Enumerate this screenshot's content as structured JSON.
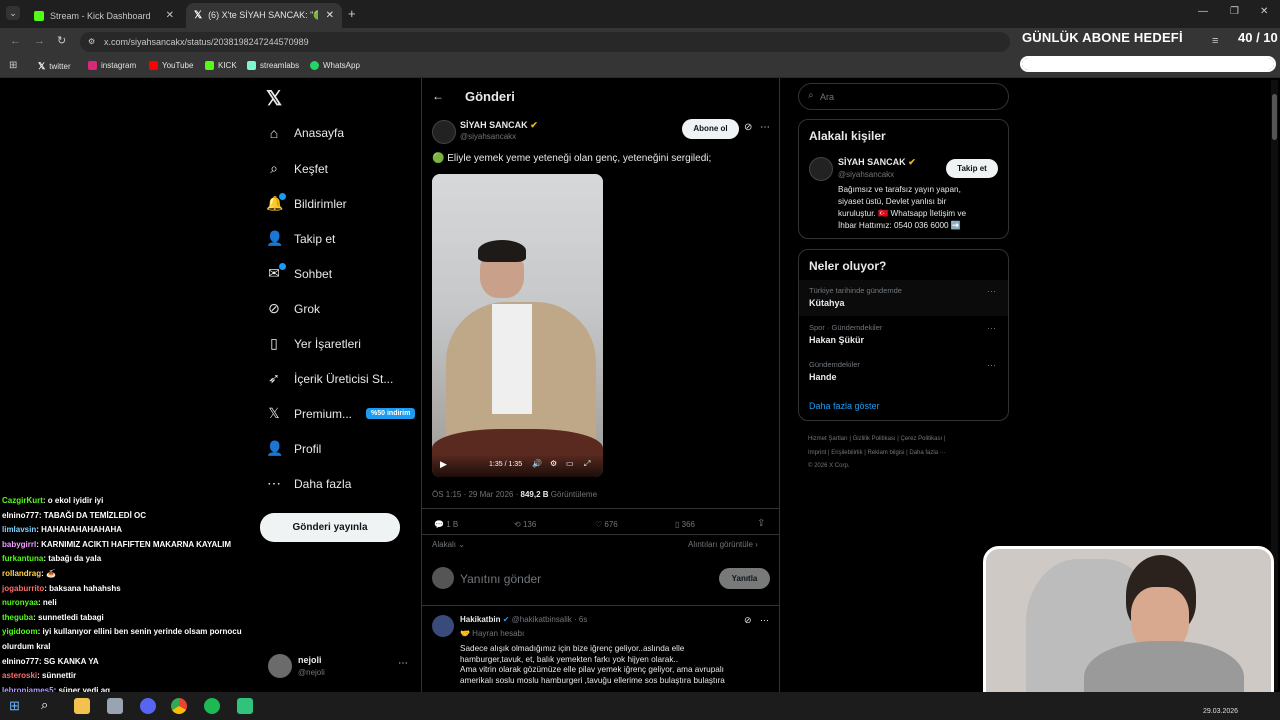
{
  "browser": {
    "tabs": [
      {
        "title": "Stream - Kick Dashboard"
      },
      {
        "title": "(6) X'te SİYAH SANCAK: \"🟢 Eli"
      }
    ],
    "url": "x.com/siyahsancakx/status/2038198247244570989",
    "bookmarks": [
      "twitter",
      "instagram",
      "YouTube",
      "KICK",
      "streamlabs",
      "WhatsApp"
    ]
  },
  "overlay": {
    "goal_title": "GÜNLÜK ABONE HEDEFİ",
    "goal_count": "40 / 10",
    "goal_progress": 1.0
  },
  "sidebar": {
    "items": [
      {
        "label": "Anasayfa",
        "icon": "home-icon"
      },
      {
        "label": "Keşfet",
        "icon": "search-icon"
      },
      {
        "label": "Bildirimler",
        "icon": "bell-icon"
      },
      {
        "label": "Takip et",
        "icon": "follow-icon"
      },
      {
        "label": "Sohbet",
        "icon": "mail-icon"
      },
      {
        "label": "Grok",
        "icon": "grok-icon"
      },
      {
        "label": "Yer İşaretleri",
        "icon": "bookmark-icon"
      },
      {
        "label": "İçerik Üreticisi St...",
        "icon": "rocket-icon"
      },
      {
        "label": "Premium...",
        "icon": "x-icon"
      },
      {
        "label": "Profil",
        "icon": "person-icon"
      },
      {
        "label": "Daha fazla",
        "icon": "more-icon"
      }
    ],
    "premium_badge": "%50 indirim",
    "post_button": "Gönderi yayınla",
    "account_name": "nejoli",
    "account_handle": "@nejoli"
  },
  "post": {
    "header": "Gönderi",
    "author": "SİYAH SANCAK",
    "handle": "@siyahsancakx",
    "subscribe": "Abone ol",
    "text": "🟢 Eliyle yemek yeme yeteneği olan genç, yeteneğini sergiledi;",
    "video_time": "1:35 / 1:35",
    "meta_time": "ÖS 1:15 · 29 Mar 2026 ·",
    "views": "849,2 B",
    "views_label": "Görüntüleme",
    "stats": {
      "replies": "1 B",
      "reposts": "136",
      "likes": "676",
      "bookmarks": "366"
    },
    "relevant": "Alakalı",
    "quotes": "Alıntıları görüntüle",
    "reply_placeholder": "Yanıtını gönder",
    "reply_button": "Yanıtla"
  },
  "reply": {
    "author": "Hakikatbin",
    "handle": "@hakikatbinsalik · 6s",
    "tag": "🤝 Hayran hesabı",
    "lines": [
      "Sadece alışık olmadığımız için bize iğrenç geliyor..aslında elle",
      "hamburger,tavuk, et, balık yemekten farkı yok hijyen olarak..",
      "Ama vitrin olarak gözümüze elle pilav yemek iğrenç geliyor, ama avrupalı",
      "amerikalı soslu moslu hamburgeri ,tavuğu ellerime sos bulaştıra bulaştıra"
    ]
  },
  "right": {
    "search_placeholder": "Ara",
    "relevant_title": "Alakalı kişiler",
    "person_name": "SİYAH SANCAK",
    "person_handle": "@siyahsancakx",
    "follow": "Takip et",
    "bio_lines": [
      "Bağımsız ve tarafsız yayın yapan,",
      "siyaset üstü, Devlet yanlısı bir",
      "kuruluştur. 🇹🇷 Whatsapp İletişim ve",
      "İhbar Hattımız: 0540 036 6000 ➡️"
    ],
    "trends_title": "Neler oluyor?",
    "trends": [
      {
        "context": "Türkiye tarihinde gündemde",
        "name": "Kütahya"
      },
      {
        "context": "Spor · Gündemdekiler",
        "name": "Hakan Şükür"
      },
      {
        "context": "Gündemdekiler",
        "name": "Hande"
      }
    ],
    "show_more": "Daha fazla göster",
    "footer_lines": [
      "Hizmet Şartları  |  Gizlilik Politikası  |  Çerez Politikası  |",
      "Imprint  |  Erişilebilirlik  |  Reklam bilgisi  |  Daha fazla ···",
      "© 2026 X Corp."
    ]
  },
  "chat": [
    {
      "user": "Cazgir­Kurt",
      "color": "#53fc18",
      "msg": ": o ekol iyidir iyi"
    },
    {
      "user": "elnino777",
      "color": "#ffffff",
      "msg": ": TABAĞI DA TEMİZLEDİ OC"
    },
    {
      "user": "limlavsin",
      "color": "#7fd1ff",
      "msg": ": HAHAHAHAHAHAHA"
    },
    {
      "user": "babygirrl",
      "color": "#f0a0ff",
      "msg": ": KARNIMIZ ACIKTI HAFIFTEN MAKARNA KAYALIM"
    },
    {
      "user": "furkantuna",
      "color": "#53fc18",
      "msg": ": tabağı da yala"
    },
    {
      "user": "rollandrag",
      "color": "#ffd24d",
      "msg": ": 🍝"
    },
    {
      "user": "jogaburrito",
      "color": "#ff6b6b",
      "msg": ": baksana hahahshs"
    },
    {
      "user": "nuronyaa",
      "color": "#53fc18",
      "msg": ": neli"
    },
    {
      "user": "theguba",
      "color": "#53fc18",
      "msg": ": sunnetledi tabagi"
    },
    {
      "user": "yigidoom",
      "color": "#53fc18",
      "msg": ": iyi kullanıyor ellini ben senin yerinde olsam pornocu"
    },
    {
      "user": "",
      "color": "#ffffff",
      "msg": "olurdum kral"
    },
    {
      "user": "elnino777",
      "color": "#ffffff",
      "msg": ": SG KANKA YA"
    },
    {
      "user": "asteroski",
      "color": "#ff6b6b",
      "msg": ": sünnettir"
    },
    {
      "user": "lebronjames5",
      "color": "#b39dff",
      "msg": ": süper yedi aq"
    }
  ],
  "taskbar": {
    "date": "29.03.2026"
  }
}
